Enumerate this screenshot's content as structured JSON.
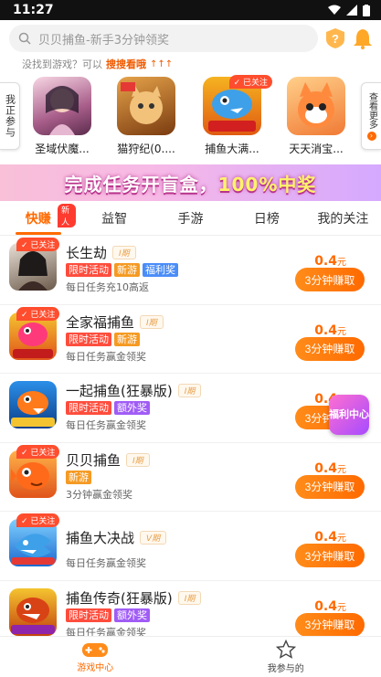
{
  "status_bar": {
    "time": "11:27"
  },
  "search": {
    "placeholder": "贝贝捕鱼-新手3分钟领奖"
  },
  "hint": {
    "text": "没找到游戏？可以",
    "link": "搜搜看哦"
  },
  "played": {
    "left_tab": "我正参与",
    "right_tab": "查看更多",
    "items": [
      {
        "name": "圣域伏魔...",
        "followed": ""
      },
      {
        "name": "猫狩纪(0....",
        "followed": ""
      },
      {
        "name": "捕鱼大满...",
        "followed": "已关注"
      },
      {
        "name": "天天消宝...",
        "followed": ""
      }
    ]
  },
  "banner": {
    "text_a": "完成任务开盲盒，",
    "text_b": "100%中奖"
  },
  "tabs": [
    {
      "label": "快赚",
      "badge": "新人"
    },
    {
      "label": "益智"
    },
    {
      "label": "手游"
    },
    {
      "label": "日榜"
    },
    {
      "label": "我的关注"
    }
  ],
  "games": [
    {
      "title": "长生劫",
      "period": "I期",
      "followed": "已关注",
      "tags": [
        "限时活动",
        "新游",
        "福利奖"
      ],
      "desc": "每日任务充10高返",
      "reward": "0.4",
      "unit": "元",
      "button": "3分钟赚取"
    },
    {
      "title": "全家福捕鱼",
      "period": "I期",
      "followed": "已关注",
      "tags": [
        "限时活动",
        "新游"
      ],
      "desc": "每日任务赢金领奖",
      "reward": "0.4",
      "unit": "元",
      "button": "3分钟赚取"
    },
    {
      "title": "一起捕鱼(狂暴版)",
      "period": "I期",
      "followed": "",
      "tags": [
        "限时活动",
        "额外奖"
      ],
      "desc": "每日任务赢金领奖",
      "reward": "0.4",
      "unit": "元",
      "button": "3分钟赚取"
    },
    {
      "title": "贝贝捕鱼",
      "period": "I期",
      "followed": "已关注",
      "tags": [
        "新游"
      ],
      "desc": "3分钟赢金领奖",
      "reward": "0.4",
      "unit": "元",
      "button": "3分钟赚取"
    },
    {
      "title": "捕鱼大决战",
      "period": "V期",
      "followed": "已关注",
      "tags": [],
      "desc": "每日任务赢金领奖",
      "reward": "0.4",
      "unit": "元",
      "button": "3分钟赚取"
    },
    {
      "title": "捕鱼传奇(狂暴版)",
      "period": "I期",
      "followed": "",
      "tags": [
        "限时活动",
        "额外奖"
      ],
      "desc": "每日任务赢金领奖",
      "reward": "0.4",
      "unit": "元",
      "button": "3分钟赚取"
    }
  ],
  "welfare_float": "福利中心",
  "bottom_nav": [
    {
      "label": "游戏中心"
    },
    {
      "label": "我参与的"
    }
  ],
  "colors": {
    "accent": "#ff6a00",
    "tag_red": "#ff4d3d",
    "tag_orange": "#f59a23",
    "tag_blue": "#4a8df8"
  }
}
